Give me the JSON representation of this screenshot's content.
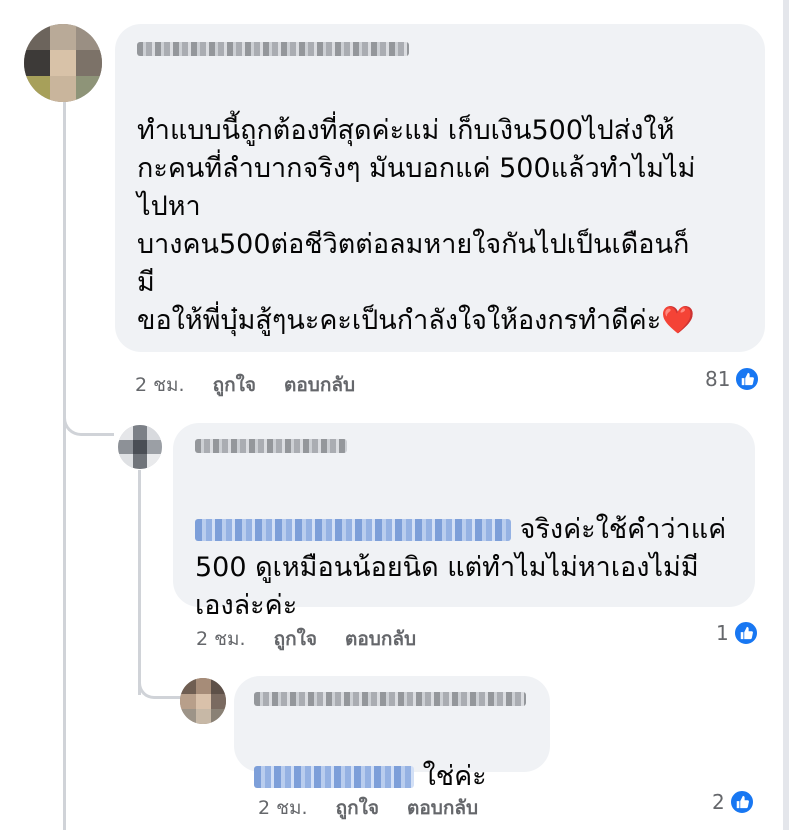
{
  "comments": [
    {
      "text_lines": "ทำแบบนี้ถูกต้องที่สุดค่ะแม่ เก็บเงิน500ไปส่งให้\nกะคนที่ลำบากจริงๆ มันบอกแค่ 500แล้วทำไมไม่\nไปหา\nบางคน500ต่อชีวิตต่อลมหายใจกันไปเป็นเดือนก็\nมี\nขอให้พี่บุ๋มสู้ๆนะคะเป็นกำลังใจให้องกรทำดีค่ะ",
      "emoji": "❤️",
      "time": "2 ชม.",
      "like_label": "ถูกใจ",
      "reply_label": "ตอบกลับ",
      "reaction_count": "81"
    },
    {
      "text_first_line": "จริงค่ะใช้คำว่าแค่",
      "text_rest": "500 ดูเหมือนน้อยนิด แต่ทำไมไม่หาเองไม่มี\nเองล่ะค่ะ",
      "time": "2 ชม.",
      "like_label": "ถูกใจ",
      "reply_label": "ตอบกลับ",
      "reaction_count": "1"
    },
    {
      "text": "ใช่ค่ะ",
      "time": "2 ชม.",
      "like_label": "ถูกใจ",
      "reply_label": "ตอบกลับ",
      "reaction_count": "2"
    }
  ],
  "colors": {
    "bubble": "#f0f2f5",
    "like_blue": "#1877f2",
    "meta_gray": "#65676b"
  },
  "icons": [
    "like-icon",
    "heart-emoji"
  ]
}
